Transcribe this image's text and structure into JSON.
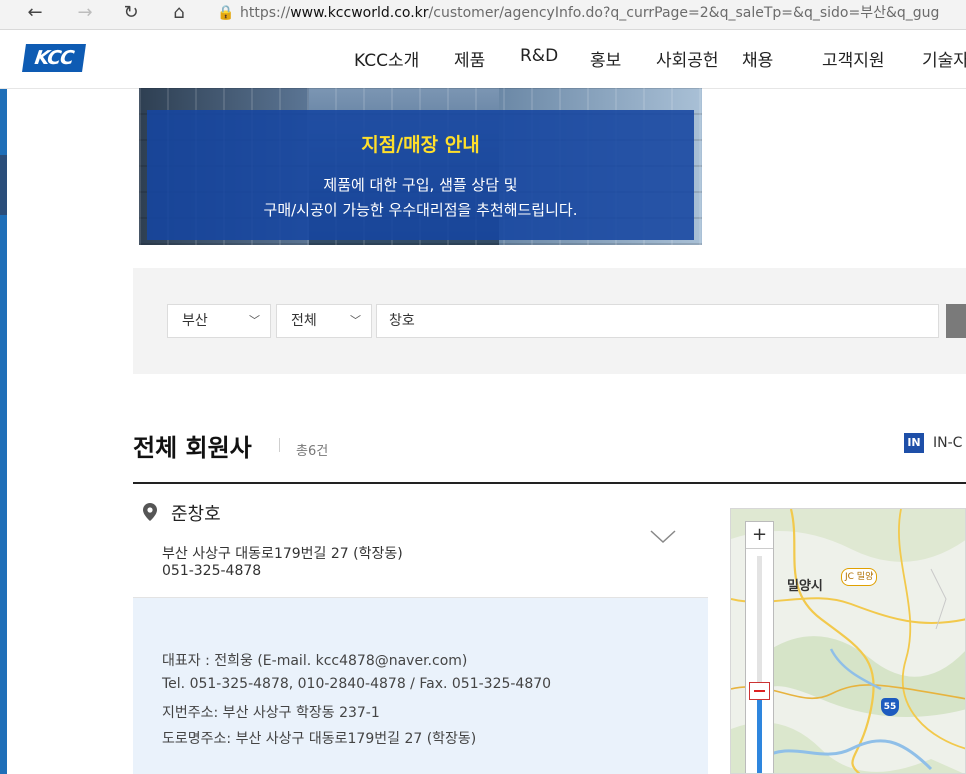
{
  "browser": {
    "url_lock": "🔒",
    "url_prefix": "https://",
    "url_host": "www.kccworld.co.kr",
    "url_rest": "/customer/agencyInfo.do?q_currPage=2&q_saleTp=&q_sido=부산&q_gug"
  },
  "site": {
    "logo": "KCC",
    "nav": [
      "KCC소개",
      "제품",
      "R&D",
      "홍보",
      "사회공헌",
      "채용",
      "고객지원",
      "기술자"
    ]
  },
  "hero": {
    "title": "지점/매장 안내",
    "line1": "제품에 대한 구입, 샘플 상담 및",
    "line2": "구매/시공이 가능한 우수대리점을 추천해드립니다."
  },
  "search": {
    "sido": "부산",
    "gugun": "전체",
    "keyword": "창호"
  },
  "results": {
    "title": "전체 회원사",
    "count": "총6건",
    "badge": "IN",
    "badge_text": "IN-C"
  },
  "item": {
    "name": "준창호",
    "address": "부산 사상구 대동로179번길 27 (학장동)",
    "phone": "051-325-4878",
    "details": [
      "대표자 : 전희웅 (E-mail. kcc4878@naver.com)",
      "Tel. 051-325-4878, 010-2840-4878 / Fax. 051-325-4870",
      "지번주소: 부산 사상구 학장동 237-1",
      "도로명주소: 부산 사상구 대동로179번길 27 (학장동)"
    ]
  },
  "map": {
    "zoom_plus": "+",
    "city_label": "밀양시",
    "jc_label": "JC 밀양",
    "route": "55"
  }
}
